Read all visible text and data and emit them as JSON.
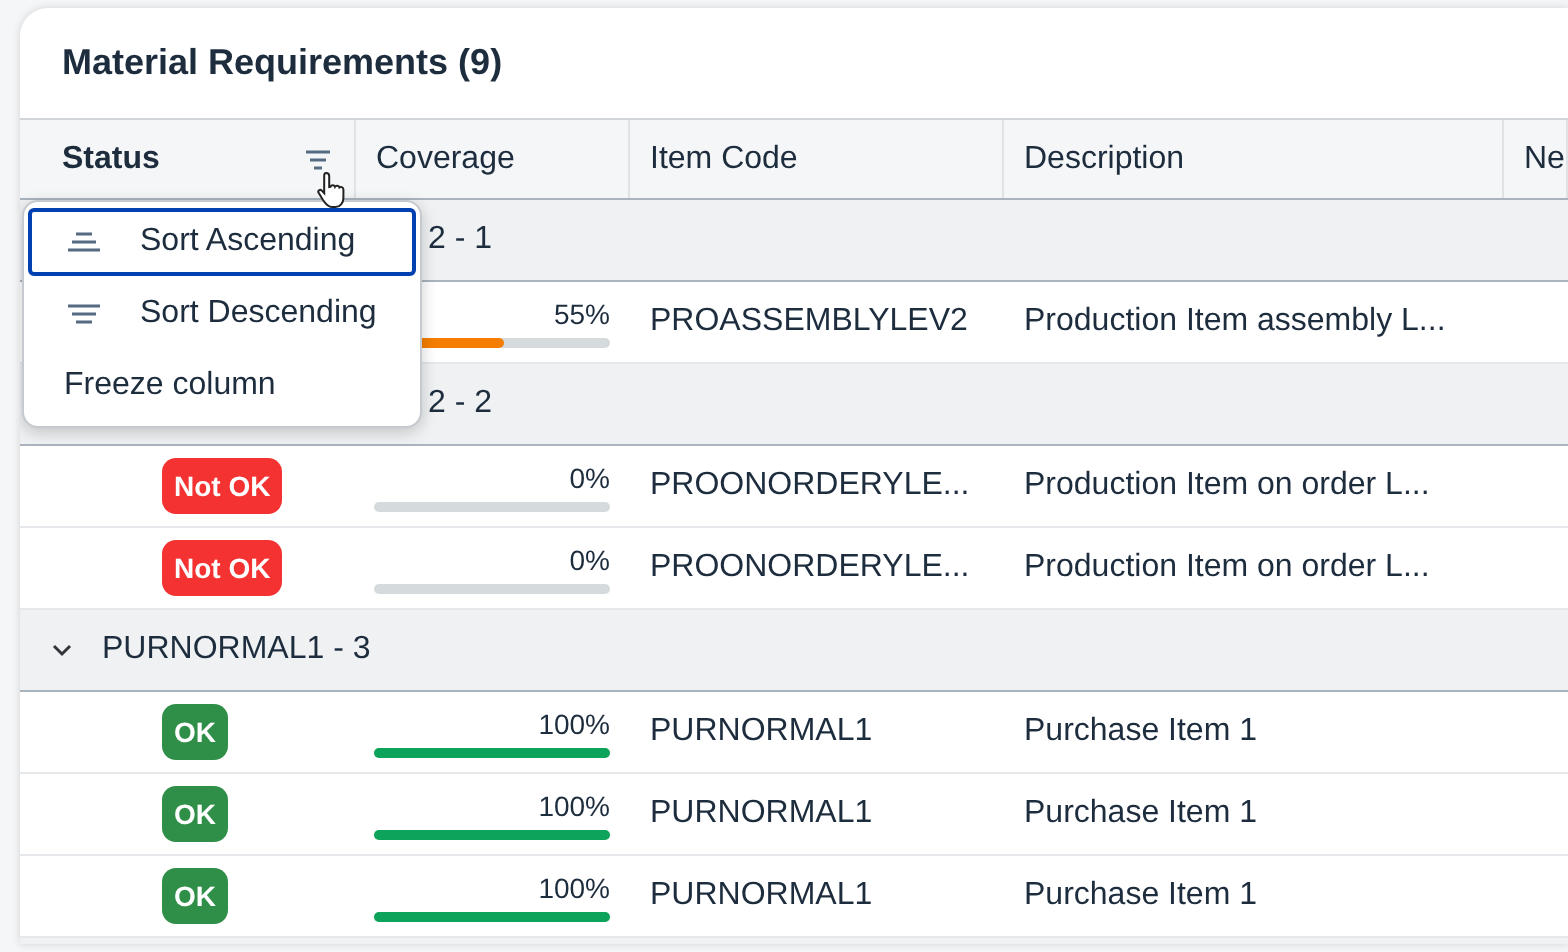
{
  "card": {
    "title": "Material Requirements (9)"
  },
  "table": {
    "columns": [
      {
        "label": "Status",
        "kind": "filter"
      },
      {
        "label": "Coverage",
        "kind": "plain"
      },
      {
        "label": "Item Code",
        "kind": "plain"
      },
      {
        "label": "Description",
        "kind": "plain"
      },
      {
        "label": "Ne",
        "kind": "plain"
      }
    ],
    "rows": [
      {
        "kind": "covered_group",
        "visible_part": "2 - 1"
      },
      {
        "kind": "item",
        "coverage": "55%",
        "level": 0.55,
        "item_code": "PROASSEMBLYLEV2",
        "description": "Production Item assembly L..."
      },
      {
        "kind": "covered_group",
        "visible_part": "2 - 2"
      },
      {
        "kind": "item",
        "status": {
          "label": "Not OK",
          "color": "#f53232"
        },
        "coverage": "0%",
        "level": 0,
        "item_code": "PROONORDERYLE...",
        "description": "Production Item on order L..."
      },
      {
        "kind": "item",
        "status": {
          "label": "Not OK",
          "color": "#f53232"
        },
        "coverage": "0%",
        "level": 0,
        "item_code": "PROONORDERYLE...",
        "description": "Production Item on order L..."
      },
      {
        "kind": "group",
        "label": "PURNORMAL1 - 3",
        "expanded": true
      },
      {
        "kind": "item",
        "status": {
          "label": "OK",
          "color": "#2f8f48"
        },
        "coverage": "100%",
        "level": 1,
        "item_code": "PURNORMAL1",
        "description": "Purchase Item 1"
      },
      {
        "kind": "item",
        "status": {
          "label": "OK",
          "color": "#2f8f48"
        },
        "coverage": "100%",
        "level": 1,
        "item_code": "PURNORMAL1",
        "description": "Purchase Item 1"
      },
      {
        "kind": "item",
        "status": {
          "label": "OK",
          "color": "#2f8f48"
        },
        "coverage": "100%",
        "level": 1,
        "item_code": "PURNORMAL1",
        "description": "Purchase Item 1"
      }
    ]
  },
  "column_menu": {
    "items": [
      {
        "label": "Sort Ascending",
        "focused": true
      },
      {
        "label": "Sort Descending",
        "focused": false
      },
      {
        "label": "Freeze column",
        "focused": false
      }
    ]
  }
}
